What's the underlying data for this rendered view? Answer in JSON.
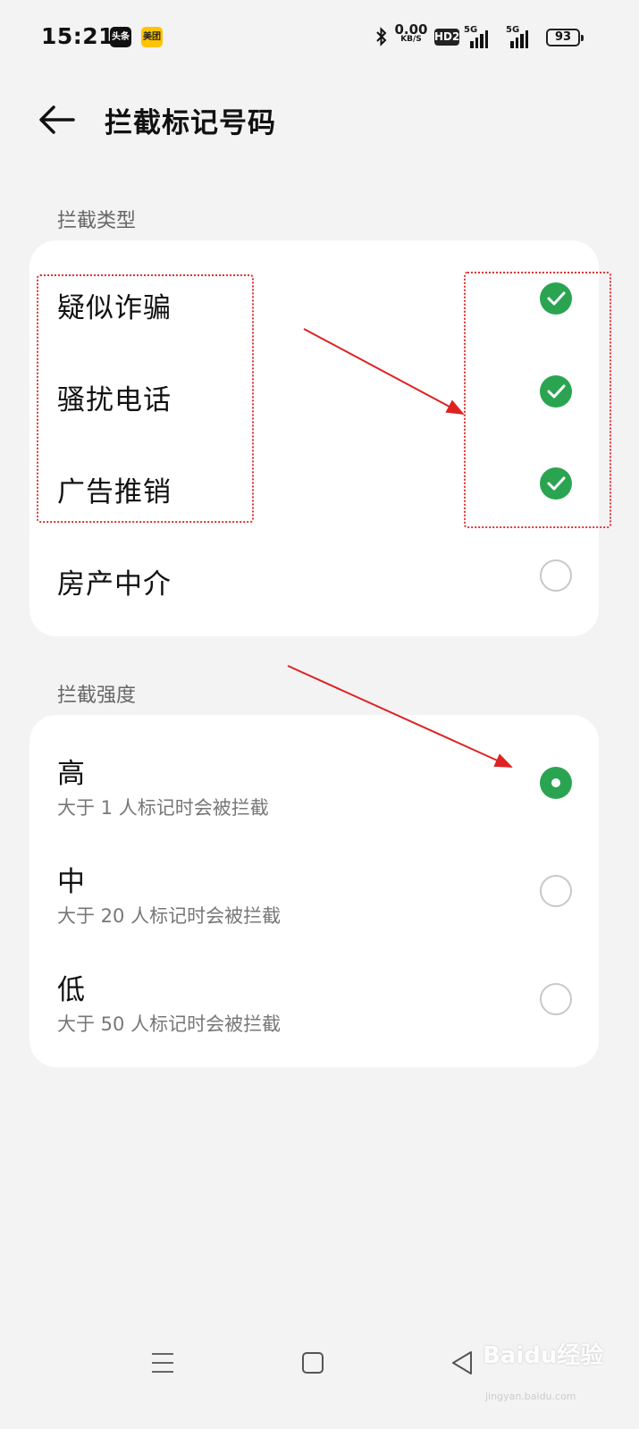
{
  "status_bar": {
    "time": "15:21",
    "app_badges": [
      "头条",
      "美团"
    ],
    "net_speed_value": "0.00",
    "net_speed_unit": "KB/S",
    "hd_badge": "HD2",
    "sim1_label": "5G",
    "sim2_label": "5G",
    "battery_level": "93"
  },
  "header": {
    "title": "拦截标记号码"
  },
  "block_types": {
    "section_label": "拦截类型",
    "items": [
      {
        "label": "疑似诈骗",
        "checked": true
      },
      {
        "label": "骚扰电话",
        "checked": true
      },
      {
        "label": "广告推销",
        "checked": true
      },
      {
        "label": "房产中介",
        "checked": false
      }
    ]
  },
  "block_strength": {
    "section_label": "拦截强度",
    "options": [
      {
        "label": "高",
        "description": "大于 1 人标记时会被拦截",
        "selected": true
      },
      {
        "label": "中",
        "description": "大于 20 人标记时会被拦截",
        "selected": false
      },
      {
        "label": "低",
        "description": "大于 50 人标记时会被拦截",
        "selected": false
      }
    ]
  },
  "colors": {
    "accent": "#2ba451",
    "annotation": "#dd2222",
    "background": "#f3f3f3"
  },
  "watermark": {
    "text": "Baidu经验",
    "sub": "jingyan.baidu.com"
  },
  "nav_icons": [
    "menu-icon",
    "home-icon",
    "back-triangle-icon"
  ]
}
